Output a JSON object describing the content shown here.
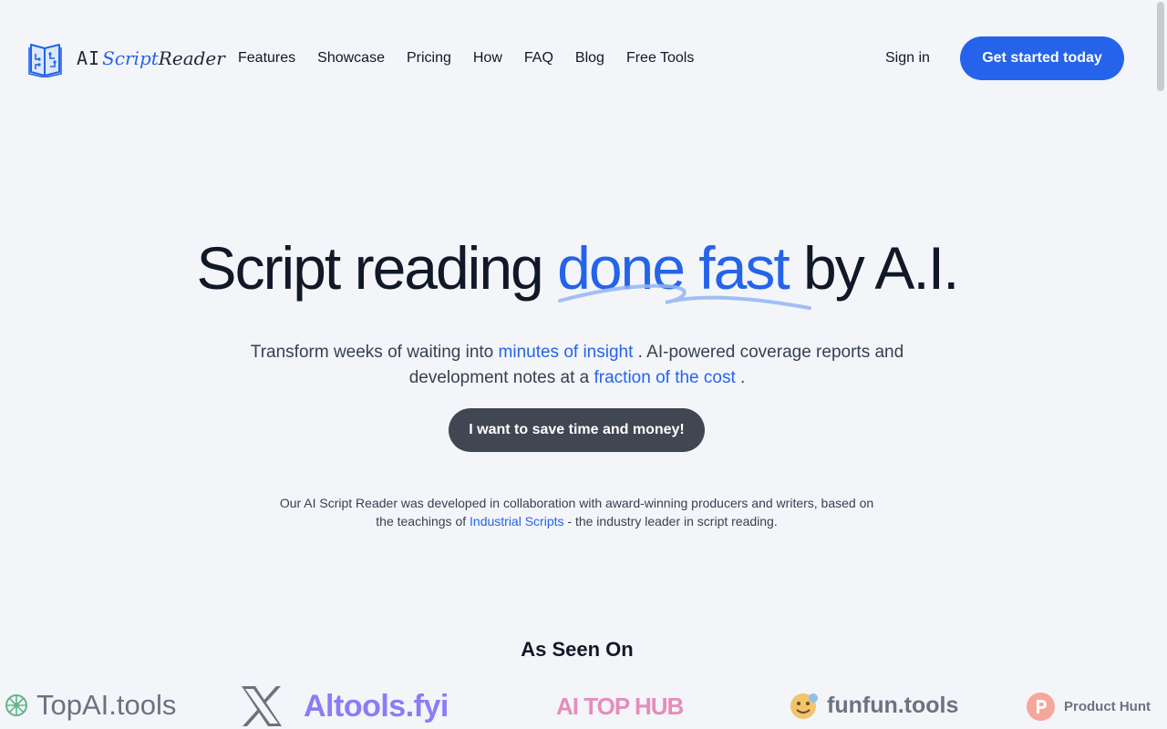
{
  "logo": {
    "ai": "AI",
    "script": "Script",
    "reader": "Reader"
  },
  "nav": [
    "Features",
    "Showcase",
    "Pricing",
    "How",
    "FAQ",
    "Blog",
    "Free Tools"
  ],
  "header": {
    "sign_in": "Sign in",
    "cta": "Get started today"
  },
  "hero": {
    "title_start": "Script reading ",
    "title_accent": "done fast",
    "title_end": " by A.I.",
    "sub_1": "Transform weeks of waiting into ",
    "sub_hl_1": "minutes of insight",
    "sub_2": " . AI-powered coverage reports and development notes at a ",
    "sub_hl_2": "fraction of the cost",
    "sub_3": " .",
    "cta": "I want to save time and money!",
    "collab_1": "Our AI Script Reader was developed in collaboration with award-winning producers and writers, based on the teachings of ",
    "collab_link": "Industrial Scripts",
    "collab_2": " - the industry leader in script reading."
  },
  "seen_on": {
    "title": "As Seen On",
    "brands": [
      "TopAI.tools",
      "Altools.fyi",
      "AI TOP HUB",
      "funfun.tools",
      "Product Hunt"
    ]
  },
  "colors": {
    "accent": "#2563eb",
    "dark_button": "#414653",
    "background": "#f3f5f8"
  }
}
